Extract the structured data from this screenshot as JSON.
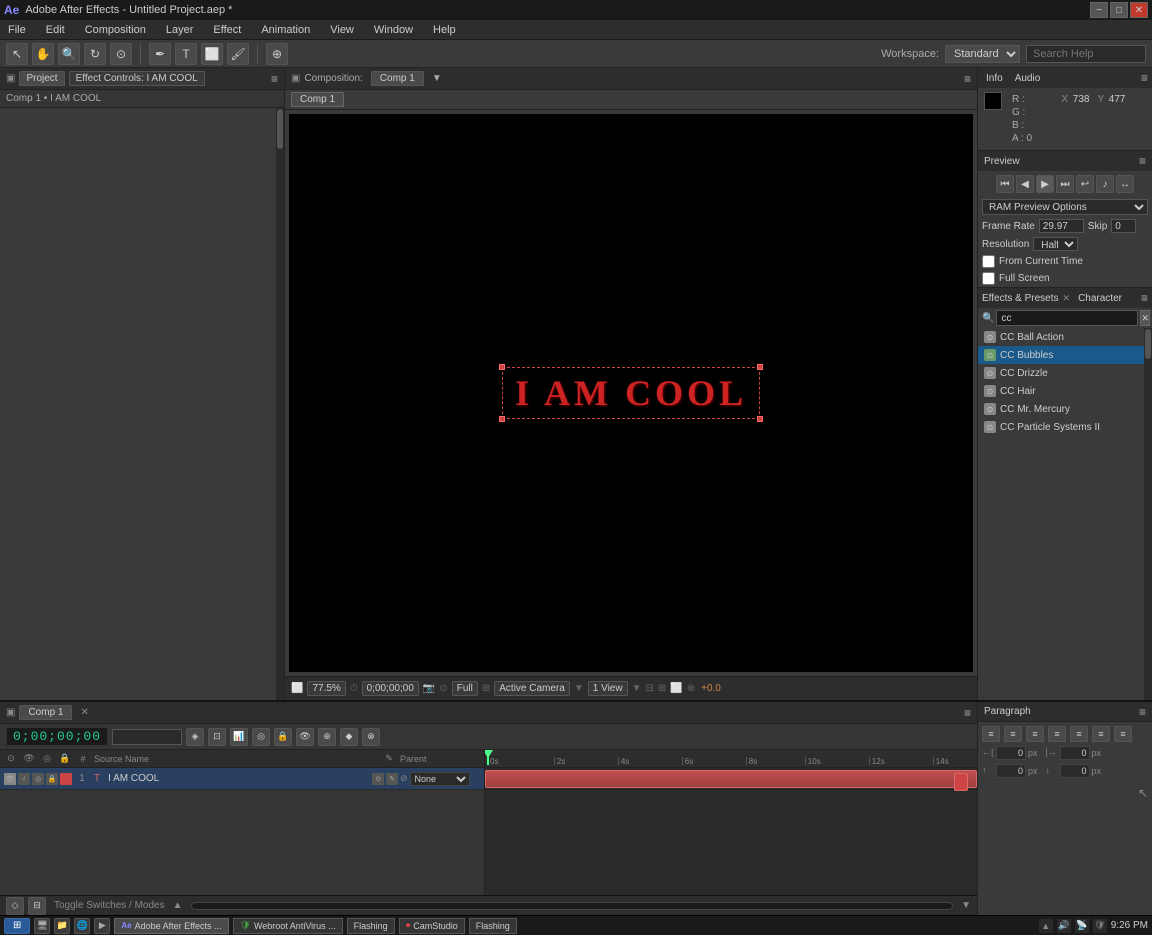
{
  "titlebar": {
    "title": "Adobe After Effects - Untitled Project.aep *",
    "controls": [
      "−",
      "□",
      "✕"
    ]
  },
  "menubar": {
    "items": [
      "File",
      "Edit",
      "Composition",
      "Layer",
      "Effect",
      "Animation",
      "View",
      "Window",
      "Help"
    ]
  },
  "toolbar": {
    "workspace_label": "Workspace:",
    "workspace": "Standard",
    "search_placeholder": "Search Help"
  },
  "left_panel": {
    "tabs": [
      "Project",
      "Effect Controls: I AM COOL"
    ],
    "breadcrumb": "Comp 1 • I AM COOL"
  },
  "composition": {
    "tab": "Comp 1",
    "header_label": "Composition: Comp 1",
    "text": "I AM COOL",
    "zoom": "77.5%",
    "timecode": "0;00;00;00",
    "resolution": "Full",
    "camera": "Active Camera",
    "view": "1 View",
    "time_offset": "+0.0"
  },
  "info_panel": {
    "tabs": [
      "Info",
      "Audio"
    ],
    "r": "R :",
    "g": "G :",
    "b": "B :",
    "a": "A : 0",
    "x_label": "X",
    "x_val": "738",
    "y_label": "Y",
    "y_val": "477"
  },
  "preview_panel": {
    "label": "Preview",
    "buttons": [
      "⏮",
      "◀",
      "▶",
      "⏭",
      "↩",
      "🔊",
      "↔"
    ],
    "ram_preview": "RAM Preview Options",
    "frame_rate_label": "Frame Rate",
    "skip_label": "Skip",
    "resolution_label": "Resolution",
    "frame_rate_val": "29.97",
    "skip_val": "0",
    "resolution_val": "Half",
    "from_current": "From Current Time",
    "full_screen": "Full Screen"
  },
  "effects_panel": {
    "label": "Effects & Presets",
    "character_tab": "Character",
    "search_placeholder": "cc",
    "items": [
      {
        "name": "CC Ball Action",
        "selected": false
      },
      {
        "name": "CC Bubbles",
        "selected": true
      },
      {
        "name": "CC Drizzle",
        "selected": false
      },
      {
        "name": "CC Hair",
        "selected": false
      },
      {
        "name": "CC Mr. Mercury",
        "selected": false
      },
      {
        "name": "CC Particle Systems II",
        "selected": false
      }
    ]
  },
  "timeline": {
    "tab": "Comp 1",
    "timecode": "0;00;00;00",
    "ruler_marks": [
      "0s",
      "2s",
      "4s",
      "6s",
      "8s",
      "10s",
      "12s",
      "14s"
    ],
    "layers": [
      {
        "num": "1",
        "name": "I AM COOL",
        "parent": "None",
        "color": "#cc4444",
        "selected": true
      }
    ],
    "toggle_label": "Toggle Switches / Modes"
  },
  "paragraph_panel": {
    "label": "Paragraph",
    "align_buttons": [
      "≡",
      "≡",
      "≡",
      "≡",
      "≡",
      "≡",
      "≡"
    ],
    "spacing_rows": [
      {
        "icon": "→|",
        "val": "0",
        "unit": "px",
        "icon2": "|←",
        "val2": "0",
        "unit2": "px"
      },
      {
        "icon": "↕",
        "val": "0",
        "unit": "px",
        "icon2": "↕",
        "val2": "0",
        "unit2": "px"
      }
    ]
  },
  "taskbar": {
    "start_label": "⊞",
    "apps": [
      {
        "label": "Adobe After Effects ...",
        "active": true
      },
      {
        "label": "Webroot AntiVirus ...",
        "active": false
      },
      {
        "label": "Flashing",
        "active": false
      },
      {
        "label": "CamStudio",
        "active": false
      },
      {
        "label": "Flashing",
        "active": false
      }
    ],
    "time": "9:26 PM"
  }
}
